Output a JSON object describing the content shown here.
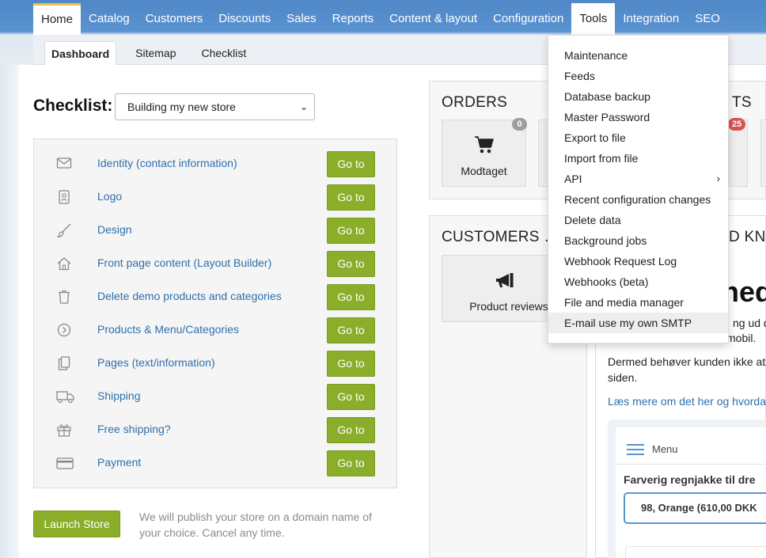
{
  "nav": {
    "items": [
      {
        "label": "Home"
      },
      {
        "label": "Catalog"
      },
      {
        "label": "Customers"
      },
      {
        "label": "Discounts"
      },
      {
        "label": "Sales"
      },
      {
        "label": "Reports"
      },
      {
        "label": "Content & layout"
      },
      {
        "label": "Configuration"
      },
      {
        "label": "Tools"
      },
      {
        "label": "Integration"
      },
      {
        "label": "SEO"
      }
    ],
    "active": "Home",
    "open": "Tools"
  },
  "subnav": {
    "tabs": [
      {
        "label": "Dashboard"
      },
      {
        "label": "Sitemap"
      },
      {
        "label": "Checklist"
      }
    ],
    "active": "Dashboard"
  },
  "checklist": {
    "title": "Checklist:",
    "selected": "Building my new store",
    "button_label": "Go to",
    "items": [
      {
        "label": "Identity (contact information)",
        "icon": "envelope-icon"
      },
      {
        "label": "Logo",
        "icon": "id-card-icon"
      },
      {
        "label": "Design",
        "icon": "paintbrush-icon"
      },
      {
        "label": "Front page content (Layout Builder)",
        "icon": "home-icon"
      },
      {
        "label": "Delete demo products and categories",
        "icon": "trash-icon"
      },
      {
        "label": "Products & Menu/Categories",
        "icon": "chevron-circle-icon"
      },
      {
        "label": "Pages (text/information)",
        "icon": "copy-icon"
      },
      {
        "label": "Shipping",
        "icon": "truck-icon"
      },
      {
        "label": "Free shipping?",
        "icon": "gift-icon"
      },
      {
        "label": "Payment",
        "icon": "credit-card-icon"
      }
    ]
  },
  "launch": {
    "button": "Launch Store",
    "note": "We will publish your store on a domain name of your choice. Cancel any time."
  },
  "orders": {
    "title": "ORDERS",
    "tile_label": "Modtaget",
    "badge": "0",
    "right_title_fragment": "TS",
    "right_badge": "25"
  },
  "customers": {
    "title": "CUSTOMERS",
    "tile_label": "Product reviews",
    "right_title_fragment": "D KN"
  },
  "article": {
    "heading_fragment": "hed",
    "line1": "ng ud de",
    "line2": "mobil.",
    "line3": "Dermed behøver kunden ikke at",
    "line4": "siden.",
    "link": "Læs mere om det her og hvorda",
    "phone_menu": "Menu",
    "phone_product": "Farverig regnjakke til dre",
    "phone_variant": "98, Orange (610,00 DKK"
  },
  "tools_menu": {
    "items": [
      {
        "label": "Maintenance"
      },
      {
        "label": "Feeds"
      },
      {
        "label": "Database backup"
      },
      {
        "label": "Master Password"
      },
      {
        "label": "Export to file"
      },
      {
        "label": "Import from file"
      },
      {
        "label": "API",
        "submenu": true
      },
      {
        "label": "Recent configuration changes"
      },
      {
        "label": "Delete data"
      },
      {
        "label": "Background jobs"
      },
      {
        "label": "Webhook Request Log"
      },
      {
        "label": "Webhooks (beta)"
      },
      {
        "label": "File and media manager"
      },
      {
        "label": "E-mail use my own SMTP"
      }
    ],
    "hovered": "E-mail use my own SMTP"
  },
  "colors": {
    "nav_bg": "#5b93d1",
    "go_button": "#8aae2a",
    "link": "#2f6fad",
    "badge_gray": "#9e9e9e",
    "badge_red": "#d9534f"
  }
}
